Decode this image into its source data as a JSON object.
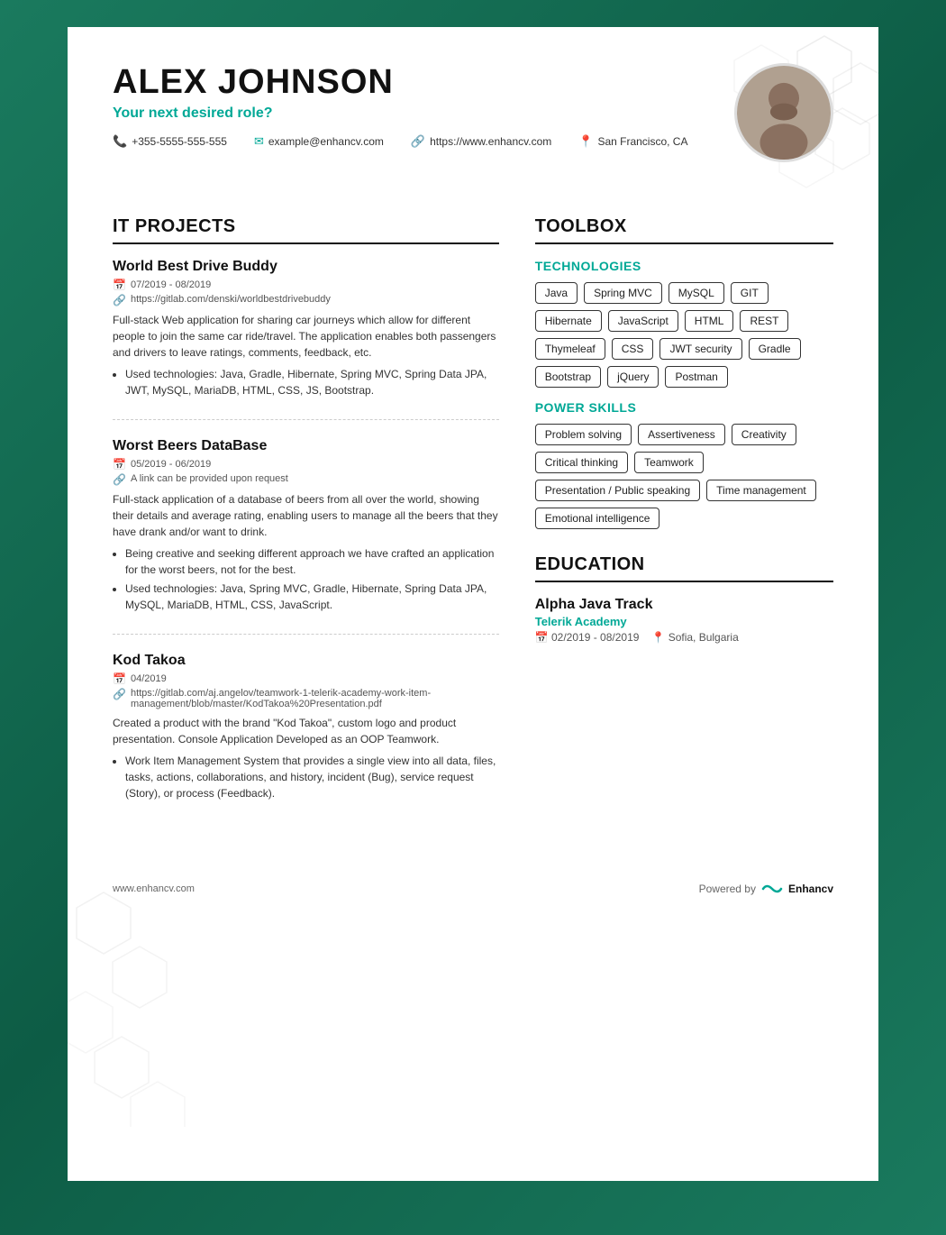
{
  "header": {
    "name": "ALEX JOHNSON",
    "role": "Your next desired role?",
    "phone": "+355-5555-555-555",
    "email": "example@enhancv.com",
    "website": "https://www.enhancv.com",
    "location": "San Francisco, CA"
  },
  "projects": {
    "section_title": "IT PROJECTS",
    "items": [
      {
        "title": "World Best Drive Buddy",
        "date": "07/2019 - 08/2019",
        "link": "https://gitlab.com/denski/worldbestdrivebuddy",
        "description": "Full-stack Web application for sharing car journeys which allow for different people to join the same car ride/travel. The application enables both passengers and drivers to leave ratings, comments, feedback, etc.",
        "bullets": [
          "Used technologies: Java, Gradle, Hibernate, Spring MVC, Spring Data JPA, JWT, MySQL, MariaDB, HTML, CSS, JS, Bootstrap."
        ]
      },
      {
        "title": "Worst Beers DataBase",
        "date": "05/2019 - 06/2019",
        "link": "A link can be provided upon request",
        "description": "Full-stack application of a database of beers from all over the world, showing their details and average rating, enabling users to manage all the beers that they have drank and/or want to drink.",
        "bullets": [
          "Being creative and seeking different approach we have crafted an application for the worst beers, not for the best.",
          "Used technologies: Java, Spring MVC, Gradle, Hibernate, Spring Data JPA, MySQL, MariaDB, HTML, CSS, JavaScript."
        ]
      },
      {
        "title": "Kod Takoa",
        "date": "04/2019",
        "link": "https://gitlab.com/aj.angelov/teamwork-1-telerik-academy-work-item-management/blob/master/KodTakoa%20Presentation.pdf",
        "description": "Created a product with the brand \"Kod Takoa\", custom logo and product presentation. Console Application Developed as an OOP Teamwork.",
        "bullets": [
          "Work Item Management System that provides a single view into all data, files, tasks, actions, collaborations, and history, incident (Bug), service request (Story), or process (Feedback)."
        ]
      }
    ]
  },
  "toolbox": {
    "section_title": "TOOLBOX",
    "technologies_title": "TECHNOLOGIES",
    "technologies": [
      "Java",
      "Spring MVC",
      "MySQL",
      "GIT",
      "Hibernate",
      "JavaScript",
      "HTML",
      "REST",
      "Thymeleaf",
      "CSS",
      "JWT security",
      "Gradle",
      "Bootstrap",
      "jQuery",
      "Postman"
    ],
    "power_skills_title": "POWER SKILLS",
    "power_skills": [
      "Problem solving",
      "Assertiveness",
      "Creativity",
      "Critical thinking",
      "Teamwork",
      "Presentation / Public speaking",
      "Time management",
      "Emotional intelligence"
    ]
  },
  "education": {
    "section_title": "EDUCATION",
    "items": [
      {
        "degree": "Alpha Java Track",
        "school": "Telerik Academy",
        "date": "02/2019 - 08/2019",
        "location": "Sofia, Bulgaria"
      }
    ]
  },
  "footer": {
    "website": "www.enhancv.com",
    "powered_by": "Powered by",
    "brand": "Enhancv"
  }
}
